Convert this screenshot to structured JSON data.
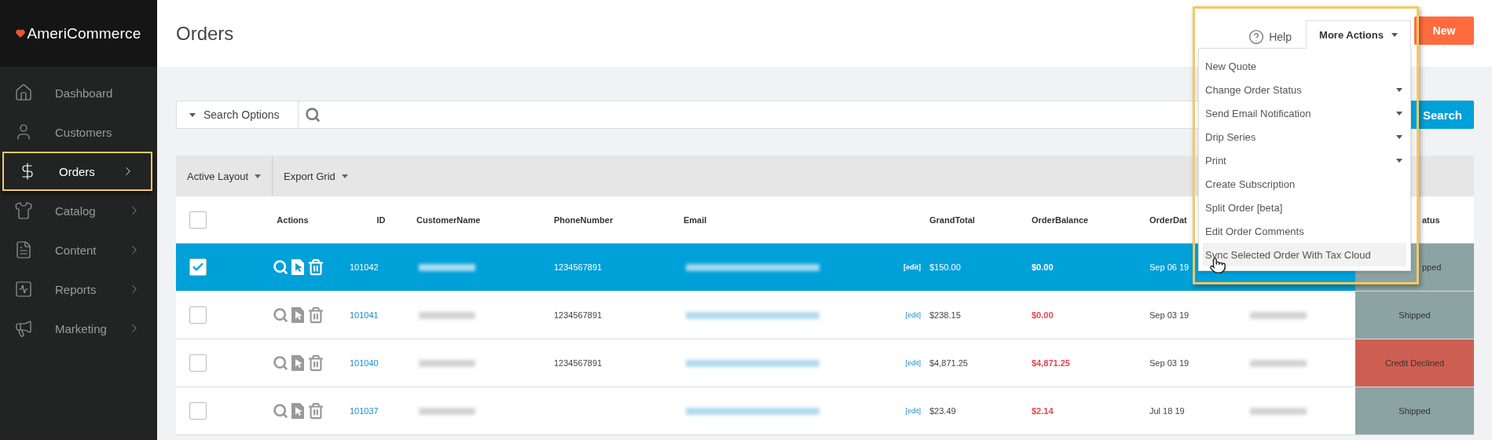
{
  "sidebar": {
    "logo": "AmeriCommerce",
    "items": [
      {
        "label": "Dashboard",
        "has_children": false,
        "selected": false
      },
      {
        "label": "Customers",
        "has_children": false,
        "selected": false
      },
      {
        "label": "Orders",
        "has_children": true,
        "selected": true
      },
      {
        "label": "Catalog",
        "has_children": true,
        "selected": false
      },
      {
        "label": "Content",
        "has_children": true,
        "selected": false
      },
      {
        "label": "Reports",
        "has_children": true,
        "selected": false
      },
      {
        "label": "Marketing",
        "has_children": true,
        "selected": false
      }
    ]
  },
  "header": {
    "title": "Orders",
    "help": "Help",
    "new_button": "New",
    "more_actions": {
      "label": "More Actions",
      "expanded": true,
      "items": [
        {
          "label": "New Quote",
          "has_submenu": false,
          "selected": false
        },
        {
          "label": "Change Order Status",
          "has_submenu": true,
          "selected": false
        },
        {
          "label": "Send Email Notification",
          "has_submenu": true,
          "selected": false
        },
        {
          "label": "Drip Series",
          "has_submenu": true,
          "selected": false
        },
        {
          "label": "Print",
          "has_submenu": true,
          "selected": false
        },
        {
          "label": "Create Subscription",
          "has_submenu": false,
          "selected": false
        },
        {
          "label": "Split Order [beta]",
          "has_submenu": false,
          "selected": false
        },
        {
          "label": "Edit Order Comments",
          "has_submenu": false,
          "selected": false
        },
        {
          "label": "Sync Selected Order With Tax Cloud",
          "has_submenu": false,
          "selected": true
        }
      ]
    }
  },
  "search": {
    "options_label": "Search Options",
    "button": "Search"
  },
  "toolbar": [
    "Active Layout",
    "Export Grid"
  ],
  "table": {
    "select_all_checked": false,
    "columns": [
      {
        "label": "Actions",
        "partly_hidden": false
      },
      {
        "label": "ID",
        "partly_hidden": false
      },
      {
        "label": "CustomerName",
        "partly_hidden": false
      },
      {
        "label": "PhoneNumber",
        "partly_hidden": false
      },
      {
        "label": "Email",
        "partly_hidden": false
      },
      {
        "label": "GrandTotal",
        "partly_hidden": false
      },
      {
        "label": "OrderBalance",
        "partly_hidden": false
      },
      {
        "label": "OrderDat",
        "partly_hidden": false
      },
      {
        "label": "atus",
        "partly_hidden": true
      }
    ],
    "rows": [
      {
        "selected": true,
        "checked": true,
        "id": "101042",
        "phone": "1234567891",
        "edit": "[edit]",
        "grand_total": "$150.00",
        "balance": "$0.00",
        "date": "Sep 06 19",
        "status": {
          "label": "pped",
          "color": "#8ca3a3",
          "partly_hidden": true
        }
      },
      {
        "selected": false,
        "checked": false,
        "id": "101041",
        "phone": "1234567891",
        "edit": "[edit]",
        "grand_total": "$238.15",
        "balance": "$0.00",
        "date": "Sep 03 19",
        "status": {
          "label": "Shipped",
          "color": "#8ca3a3",
          "partly_hidden": false
        }
      },
      {
        "selected": false,
        "checked": false,
        "id": "101040",
        "phone": "1234567891",
        "edit": "[edit]",
        "grand_total": "$4,871.25",
        "balance": "$4,871.25",
        "date": "Sep 03 19",
        "status": {
          "label": "Credit Declined",
          "color": "#cd5f52",
          "partly_hidden": false
        }
      },
      {
        "selected": false,
        "checked": false,
        "id": "101037",
        "edit": "[edit]",
        "grand_total": "$23.49",
        "balance": "$2.14",
        "date": "Jul 18 19",
        "status": {
          "label": "Shipped",
          "color": "#8ca3a3",
          "partly_hidden": false
        }
      }
    ]
  }
}
